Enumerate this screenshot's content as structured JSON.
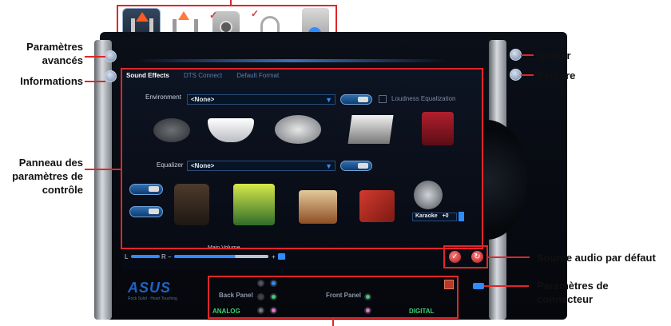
{
  "annotations": {
    "advanced_settings": "Paramètres avancés",
    "information": "Informations",
    "control_panel": "Panneau des paramètres de contrôle",
    "quit": "Quitter",
    "minimize": "Réduire",
    "default_audio_source": "Source audio par défaut",
    "connector_settings": "Paramètres de connecteur"
  },
  "tabs": [
    "Sound Effects",
    "DTS Connect",
    "Default Format"
  ],
  "environment": {
    "label": "Environment",
    "value": "<None>",
    "loudness_label": "Loudness Equalization"
  },
  "equalizer": {
    "label": "Equalizer",
    "value": "<None>"
  },
  "karaoke": {
    "label": "Karaoke",
    "value": "+0"
  },
  "volume": {
    "label": "Main Volume",
    "left": "L",
    "right": "R",
    "minus": "−",
    "plus": "+"
  },
  "connectors": {
    "back_panel": "Back Panel",
    "front_panel": "Front Panel",
    "analog": "ANALOG",
    "digital": "DIGITAL"
  },
  "brand": {
    "logo": "ASUS",
    "tagline": "Rock Solid · Heart Touching"
  },
  "colors": {
    "accent": "#e0262a",
    "panel_blue": "#2e8cff",
    "analog_green": "#3bd16f"
  }
}
